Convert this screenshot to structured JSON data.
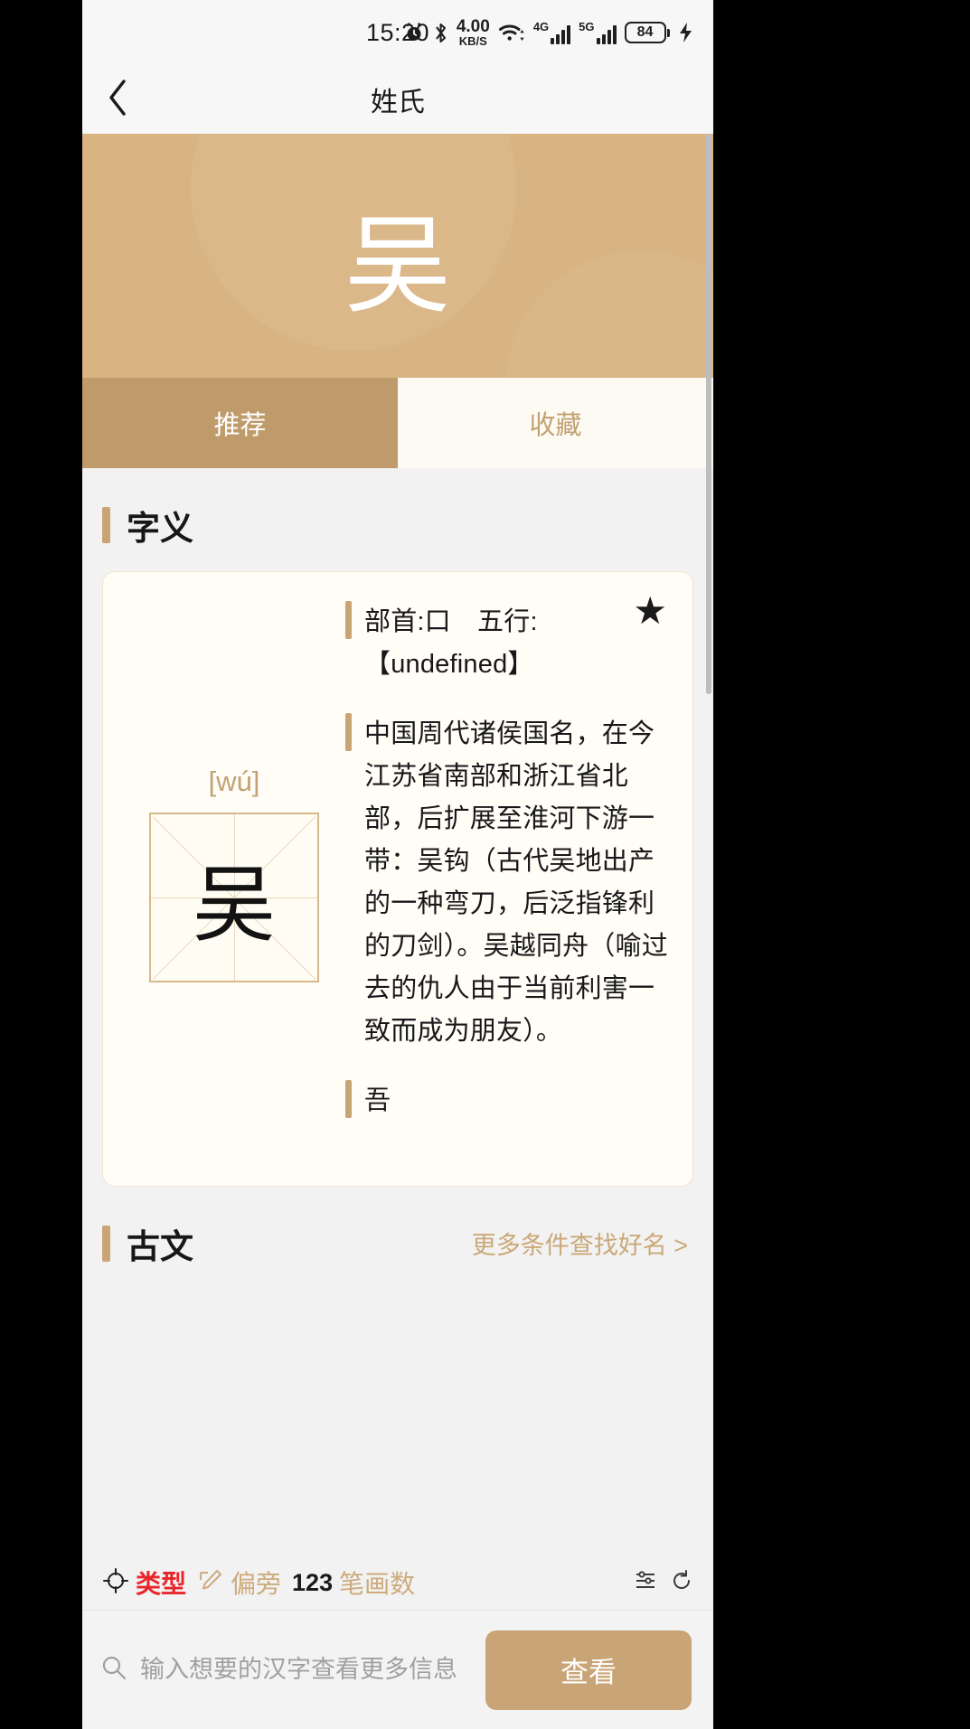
{
  "status_bar": {
    "time": "15:20",
    "net_speed_value": "4.00",
    "net_speed_unit": "KB/S",
    "net_4g_label": "4G",
    "net_5g_label": "5G",
    "battery_percent": "84",
    "icons": [
      "alarm-icon",
      "bluetooth-icon",
      "wifi-icon",
      "signal-4g-icon",
      "signal-5g-icon",
      "battery-icon",
      "charging-bolt-icon"
    ]
  },
  "nav": {
    "back_icon": "chevron-left-icon",
    "title": "姓氏"
  },
  "hero": {
    "character": "吴"
  },
  "tabs": [
    {
      "label": "推荐",
      "active": true
    },
    {
      "label": "收藏",
      "active": false
    }
  ],
  "sections": {
    "meaning": {
      "title": "字义",
      "star_icon": "star-filled-icon",
      "pinyin": "[wú]",
      "character": "吴",
      "blocks": [
        "部首:口　五行:【undefined】",
        "中国周代诸侯国名，在今江苏省南部和浙江省北部，后扩展至淮河下游一带：吴钩（古代吴地出产的一种弯刀，后泛指锋利的刀剑）。吴越同舟（喻过去的仇人由于当前利害一致而成为朋友）。",
        "吾"
      ]
    },
    "ancient": {
      "title": "古文",
      "more_link": "更多条件查找好名 >"
    }
  },
  "filters": [
    {
      "name": "type",
      "icon": "target-icon",
      "label": "类型",
      "color": "#e8262b"
    },
    {
      "name": "radical",
      "icon": "pencil-icon",
      "label": "偏旁",
      "color": "#cdab7c"
    },
    {
      "name": "strokes",
      "icon": "123-icon",
      "prefix": "123",
      "label": "笔画数",
      "color": "#cdab7c"
    }
  ],
  "search": {
    "icon": "search-icon",
    "placeholder": "输入想要的汉字查看更多信息",
    "value": "",
    "button_label": "查看"
  },
  "colors": {
    "brand_tan": "#c9a476",
    "hero_tan": "#d9b483",
    "tab_active": "#bf9a6a",
    "card_bg": "#fffdf6",
    "accent_red": "#e8262b"
  }
}
